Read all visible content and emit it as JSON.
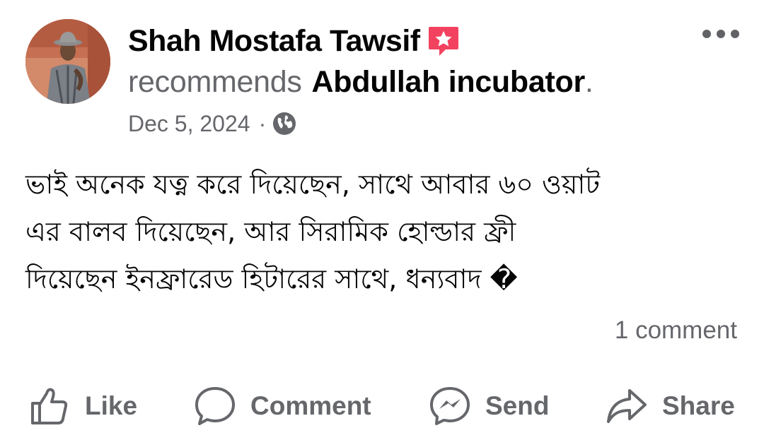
{
  "post": {
    "author_name": "Shah Mostafa Tawsif",
    "recommends_verb": "recommends",
    "page_name": "Abdullah incubator",
    "period": ".",
    "date": "Dec 5, 2024",
    "meta_separator": "·",
    "privacy_icon": "globe-icon",
    "badge_icon": "recommendation-star-icon",
    "more_icon": "more-options-icon",
    "body_lines": [
      "ভাই অনেক যত্ন করে দিয়েছেন, সাথে আবার ৬০ ওয়াট",
      "এর বালব দিয়েছেন, আর সিরামিক হোল্ডার ফ্রী",
      "দিয়েছেন ইনফ্রারেড হিটারের সাথে, ধন্যবাদ �"
    ],
    "comments_count": "1 comment"
  },
  "actions": {
    "like_label": "Like",
    "comment_label": "Comment",
    "send_label": "Send",
    "share_label": "Share"
  },
  "colors": {
    "text_primary": "#050505",
    "text_secondary": "#65676b",
    "badge": "#f3425f",
    "background": "#ffffff"
  }
}
